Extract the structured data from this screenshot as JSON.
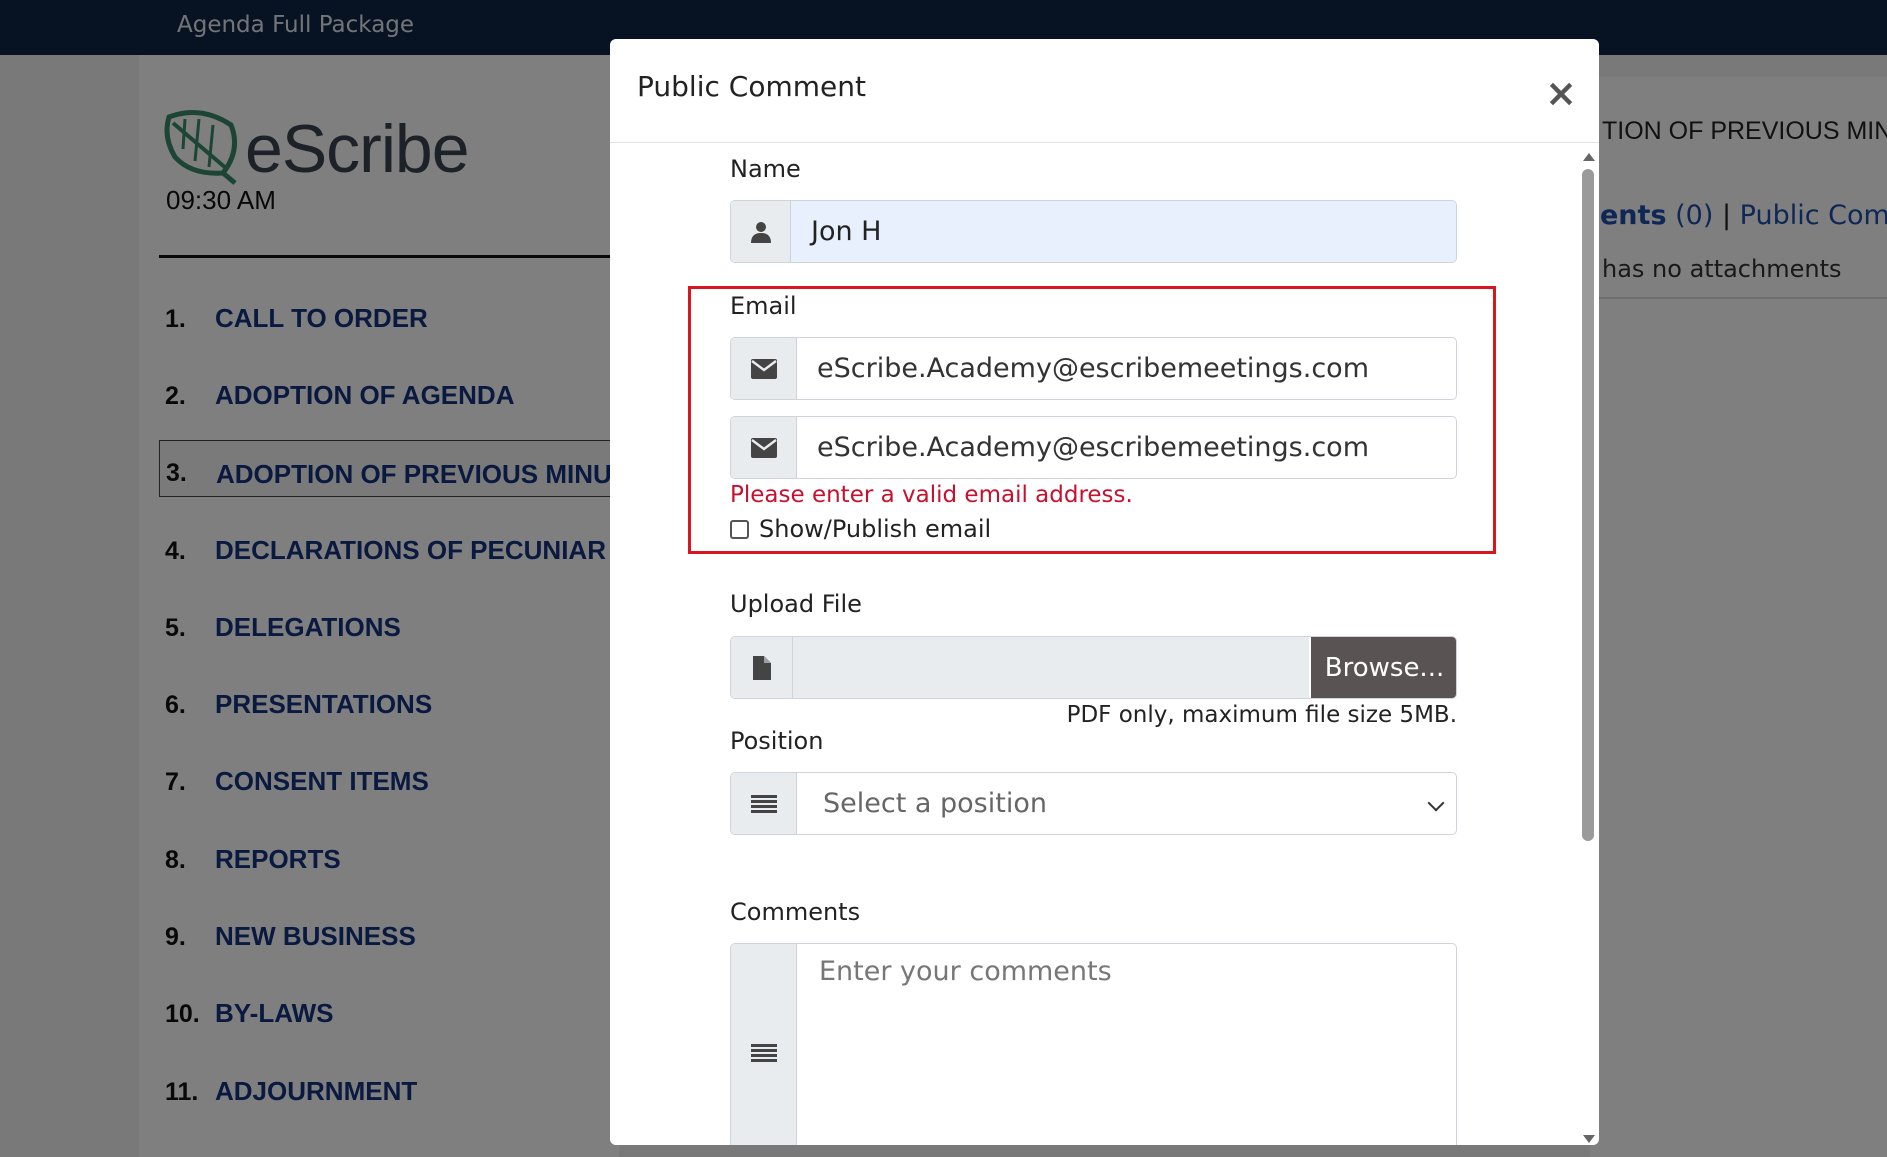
{
  "topbar": {
    "title": "Agenda Full Package"
  },
  "agenda": {
    "logo_text": "eScribe",
    "time": "09:30 AM",
    "items": [
      {
        "num": "1.",
        "label": "CALL TO ORDER"
      },
      {
        "num": "2.",
        "label": "ADOPTION OF AGENDA"
      },
      {
        "num": "3.",
        "label": "ADOPTION OF PREVIOUS MINU"
      },
      {
        "num": "4.",
        "label": "DECLARATIONS OF PECUNIAR"
      },
      {
        "num": "5.",
        "label": "DELEGATIONS"
      },
      {
        "num": "6.",
        "label": "PRESENTATIONS"
      },
      {
        "num": "7.",
        "label": "CONSENT ITEMS"
      },
      {
        "num": "8.",
        "label": "REPORTS"
      },
      {
        "num": "9.",
        "label": "NEW BUSINESS"
      },
      {
        "num": "10.",
        "label": "BY-LAWS"
      },
      {
        "num": "11.",
        "label": "ADJOURNMENT"
      }
    ]
  },
  "right_panel": {
    "heading": "TION OF PREVIOUS MINUTE",
    "attachments_link": "ents",
    "attachments_count": "(0)",
    "separator": "|",
    "public_comments_link": "Public Comme",
    "note": "has no attachments"
  },
  "modal": {
    "title": "Public Comment",
    "close_label": "×",
    "name": {
      "label": "Name",
      "value": "Jon H"
    },
    "email": {
      "label": "Email",
      "value": "eScribe.Academy@escribemeetings.com",
      "confirm_value": "eScribe.Academy@escribemeetings.com",
      "error": "Please enter a valid email address.",
      "publish_label": "Show/Publish email"
    },
    "upload": {
      "label": "Upload File",
      "browse_label": "Browse...",
      "hint": "PDF only, maximum file size 5MB."
    },
    "position": {
      "label": "Position",
      "placeholder": "Select a position"
    },
    "comments": {
      "label": "Comments",
      "placeholder": "Enter your comments"
    }
  },
  "colors": {
    "topbar": "#0f2646",
    "agenda_link": "#12337f",
    "error": "#c8102e",
    "highlight_box": "#d9161e",
    "browse_button": "#5a5353",
    "autofill": "#e8f0fe"
  },
  "icons": {
    "name_field": "user-icon",
    "email_field": "envelope-icon",
    "upload_field": "file-icon",
    "position_field": "list-icon",
    "comments_field": "list-icon",
    "close": "close-icon"
  }
}
